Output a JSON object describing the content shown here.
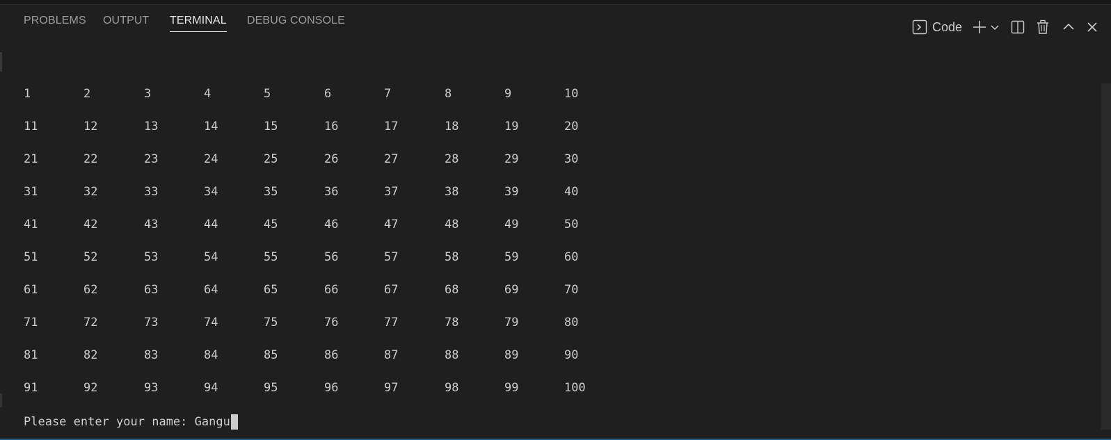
{
  "panel": {
    "tabs": [
      {
        "label": "PROBLEMS",
        "active": false
      },
      {
        "label": "OUTPUT",
        "active": false
      },
      {
        "label": "TERMINAL",
        "active": true
      },
      {
        "label": "DEBUG CONSOLE",
        "active": false
      }
    ],
    "actions": {
      "terminal_profile_icon": "terminal-icon",
      "terminal_name": "Code",
      "new_terminal_icon": "plus-icon",
      "launch_profile_icon": "chevron-down-icon",
      "split_icon": "split-terminal-icon",
      "kill_icon": "trash-icon",
      "maximize_icon": "chevron-up-icon",
      "close_icon": "close-icon"
    }
  },
  "terminal": {
    "rows": [
      [
        "1",
        "2",
        "3",
        "4",
        "5",
        "6",
        "7",
        "8",
        "9",
        "10"
      ],
      [
        "11",
        "12",
        "13",
        "14",
        "15",
        "16",
        "17",
        "18",
        "19",
        "20"
      ],
      [
        "21",
        "22",
        "23",
        "24",
        "25",
        "26",
        "27",
        "28",
        "29",
        "30"
      ],
      [
        "31",
        "32",
        "33",
        "34",
        "35",
        "36",
        "37",
        "38",
        "39",
        "40"
      ],
      [
        "41",
        "42",
        "43",
        "44",
        "45",
        "46",
        "47",
        "48",
        "49",
        "50"
      ],
      [
        "51",
        "52",
        "53",
        "54",
        "55",
        "56",
        "57",
        "58",
        "59",
        "60"
      ],
      [
        "61",
        "62",
        "63",
        "64",
        "65",
        "66",
        "67",
        "68",
        "69",
        "70"
      ],
      [
        "71",
        "72",
        "73",
        "74",
        "75",
        "76",
        "77",
        "78",
        "79",
        "80"
      ],
      [
        "81",
        "82",
        "83",
        "84",
        "85",
        "86",
        "87",
        "88",
        "89",
        "90"
      ],
      [
        "91",
        "92",
        "93",
        "94",
        "95",
        "96",
        "97",
        "98",
        "99",
        "100"
      ]
    ],
    "prompt": "Please enter your name: ",
    "input_value": "Gangu"
  },
  "colors": {
    "background": "#1f1f1f",
    "text": "#cccccc",
    "active_tab": "#e7e7e7",
    "inactive_tab": "#9d9d9d",
    "accent": "#0e639c"
  }
}
